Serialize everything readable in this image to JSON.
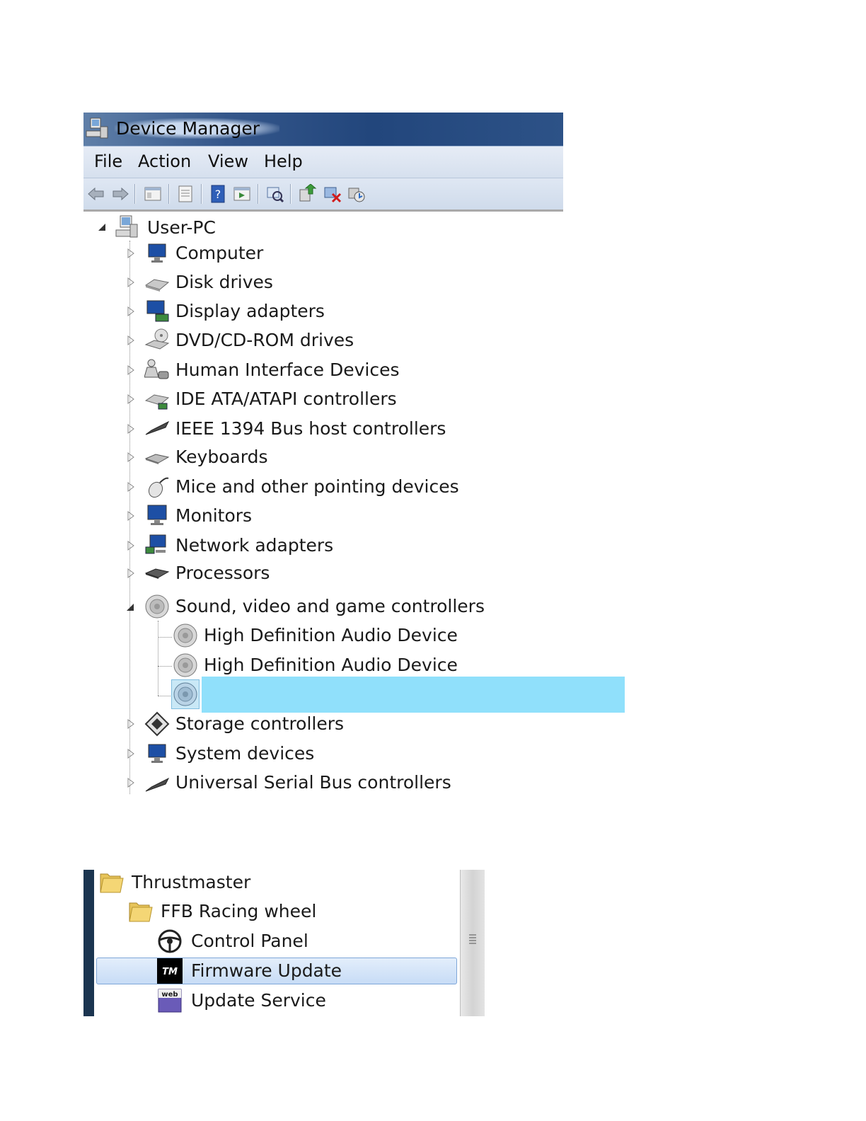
{
  "window": {
    "title": "Device Manager"
  },
  "menu": [
    "File",
    "Action",
    "View",
    "Help"
  ],
  "toolbar": {
    "buttons": [
      "back-icon",
      "forward-icon",
      "properties-pane-icon",
      "properties-icon",
      "help-icon",
      "show-hidden-icon",
      "scan-hardware-icon",
      "update-driver-icon",
      "uninstall-icon",
      "disable-icon"
    ]
  },
  "tree": {
    "root": "User-PC",
    "items": [
      {
        "label": "Computer",
        "icon": "computer-icon",
        "expanded": false
      },
      {
        "label": "Disk drives",
        "icon": "disk-drive-icon",
        "expanded": false
      },
      {
        "label": "Display adapters",
        "icon": "display-adapter-icon",
        "expanded": false
      },
      {
        "label": "DVD/CD-ROM drives",
        "icon": "dvd-drive-icon",
        "expanded": false
      },
      {
        "label": "Human Interface Devices",
        "icon": "hid-icon",
        "expanded": false
      },
      {
        "label": "IDE ATA/ATAPI controllers",
        "icon": "ide-controller-icon",
        "expanded": false
      },
      {
        "label": "IEEE 1394 Bus host controllers",
        "icon": "ieee1394-icon",
        "expanded": false
      },
      {
        "label": "Keyboards",
        "icon": "keyboard-icon",
        "expanded": false
      },
      {
        "label": "Mice and other pointing devices",
        "icon": "mouse-icon",
        "expanded": false
      },
      {
        "label": "Monitors",
        "icon": "monitor-icon",
        "expanded": false
      },
      {
        "label": "Network adapters",
        "icon": "network-adapter-icon",
        "expanded": false
      },
      {
        "label": "Processors",
        "icon": "processor-icon",
        "expanded": false
      },
      {
        "label": "Sound, video and game controllers",
        "icon": "speaker-icon",
        "expanded": true,
        "children": [
          "High Definition Audio Device",
          "High Definition Audio Device",
          ""
        ]
      },
      {
        "label": "Storage controllers",
        "icon": "storage-controller-icon",
        "expanded": false
      },
      {
        "label": "System devices",
        "icon": "system-devices-icon",
        "expanded": false
      },
      {
        "label": "Universal Serial Bus controllers",
        "icon": "usb-icon",
        "expanded": false
      }
    ]
  },
  "colors": {
    "selection_highlight": "#90e0fb",
    "titlebar": "#22467c"
  },
  "start_menu": {
    "items": [
      {
        "label": "Thrustmaster",
        "icon": "folder-icon"
      },
      {
        "label": "FFB Racing wheel",
        "icon": "folder-icon"
      },
      {
        "label": "Control Panel",
        "icon": "steering-wheel-icon"
      },
      {
        "label": "Firmware Update",
        "icon": "tm-logo-icon",
        "highlighted": true
      },
      {
        "label": "Update Service",
        "icon": "web-icon"
      }
    ]
  }
}
